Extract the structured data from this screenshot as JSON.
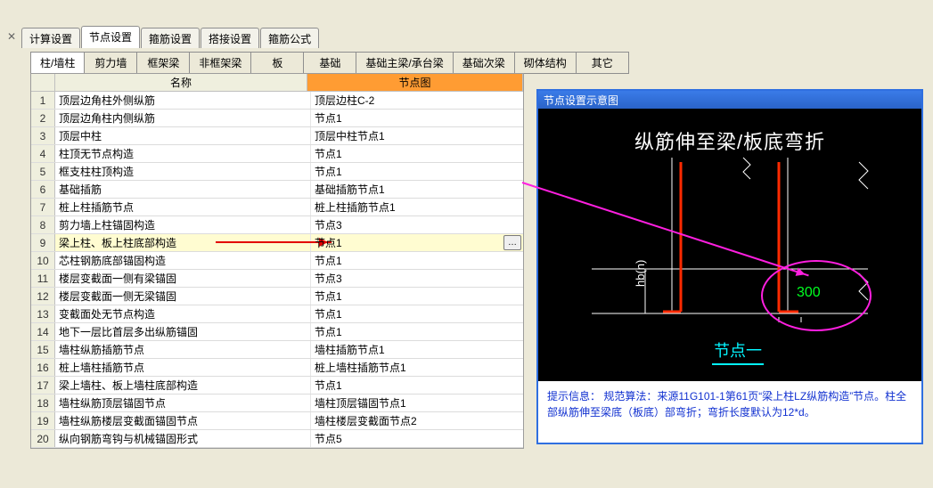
{
  "window": {
    "close_icon": "✕"
  },
  "top_tabs": [
    "计算设置",
    "节点设置",
    "箍筋设置",
    "搭接设置",
    "箍筋公式"
  ],
  "top_tabs_active": 1,
  "inner_tabs": [
    "柱/墙柱",
    "剪力墙",
    "框架梁",
    "非框架梁",
    "板",
    "基础",
    "基础主梁/承台梁",
    "基础次梁",
    "砌体结构",
    "其它"
  ],
  "inner_tabs_active": 0,
  "table": {
    "headers": {
      "num": "",
      "name": "名称",
      "node": "节点图"
    },
    "selected_index": 8,
    "rows": [
      {
        "n": "1",
        "name": "顶层边角柱外侧纵筋",
        "node": "顶层边柱C-2"
      },
      {
        "n": "2",
        "name": "顶层边角柱内侧纵筋",
        "node": "节点1"
      },
      {
        "n": "3",
        "name": "顶层中柱",
        "node": "顶层中柱节点1"
      },
      {
        "n": "4",
        "name": "柱顶无节点构造",
        "node": "节点1"
      },
      {
        "n": "5",
        "name": "框支柱柱顶构造",
        "node": "节点1"
      },
      {
        "n": "6",
        "name": "基础插筋",
        "node": "基础插筋节点1"
      },
      {
        "n": "7",
        "name": "桩上柱插筋节点",
        "node": "桩上柱插筋节点1"
      },
      {
        "n": "8",
        "name": "剪力墙上柱锚固构造",
        "node": "节点3"
      },
      {
        "n": "9",
        "name": "梁上柱、板上柱底部构造",
        "node": "节点1"
      },
      {
        "n": "10",
        "name": "芯柱钢筋底部锚固构造",
        "node": "节点1"
      },
      {
        "n": "11",
        "name": "楼层变截面一侧有梁锚固",
        "node": "节点3"
      },
      {
        "n": "12",
        "name": "楼层变截面一侧无梁锚固",
        "node": "节点1"
      },
      {
        "n": "13",
        "name": "变截面处无节点构造",
        "node": "节点1"
      },
      {
        "n": "14",
        "name": "地下一层比首层多出纵筋锚固",
        "node": "节点1"
      },
      {
        "n": "15",
        "name": "墙柱纵筋插筋节点",
        "node": "墙柱插筋节点1"
      },
      {
        "n": "16",
        "name": "桩上墙柱插筋节点",
        "node": "桩上墙柱插筋节点1"
      },
      {
        "n": "17",
        "name": "梁上墙柱、板上墙柱底部构造",
        "node": "节点1"
      },
      {
        "n": "18",
        "name": "墙柱纵筋顶层锚固节点",
        "node": "墙柱顶层锚固节点1"
      },
      {
        "n": "19",
        "name": "墙柱纵筋楼层变截面锚固节点",
        "node": "墙柱楼层变截面节点2"
      },
      {
        "n": "20",
        "name": "纵向钢筋弯钩与机械锚固形式",
        "node": "节点5"
      }
    ],
    "ellipsis": "…"
  },
  "diagram": {
    "title": "节点设置示意图",
    "heading": "纵筋伸至梁/板底弯折",
    "value_300": "300",
    "hbn": "hb(n)",
    "bottom_label": "节点一",
    "footer_label": "提示信息：",
    "footer_text": "规范算法：来源11G101-1第61页“梁上柱LZ纵筋构造”节点。柱全部纵筋伸至梁底（板底）部弯折；弯折长度默认为12*d。"
  }
}
